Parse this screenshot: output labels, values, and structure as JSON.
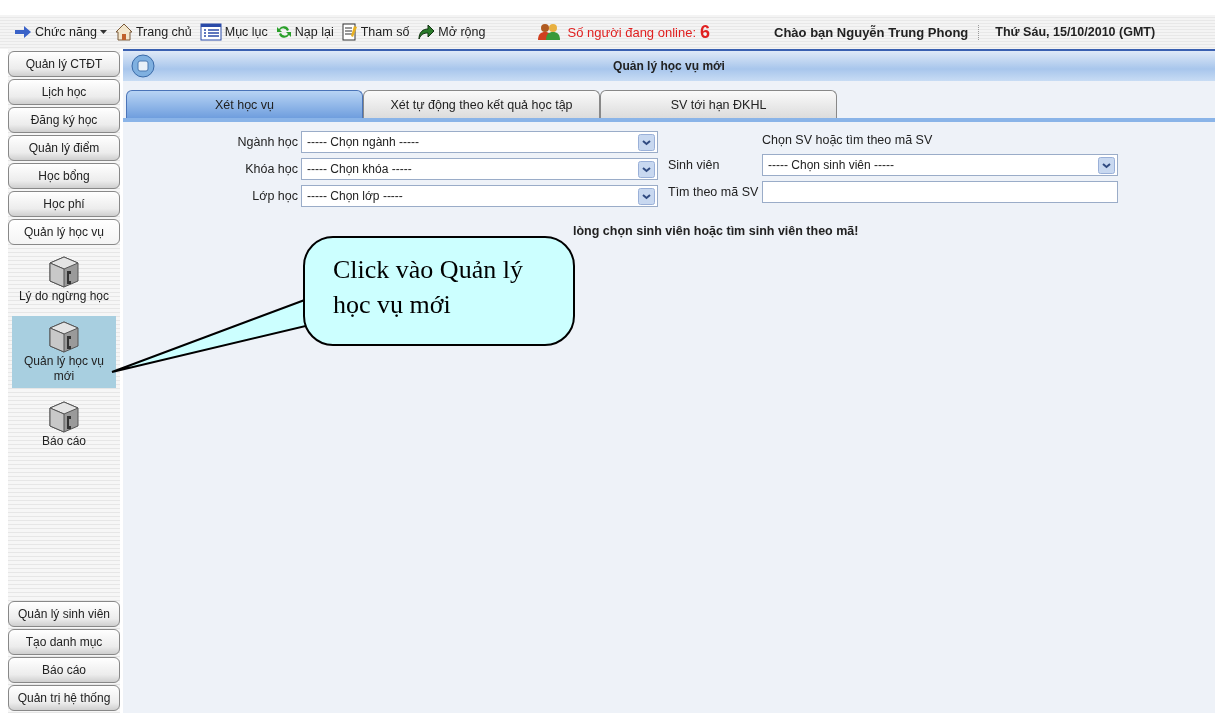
{
  "toolbar": {
    "items": [
      {
        "kind": "menu",
        "label": "Chức năng",
        "dropdown": true
      },
      {
        "kind": "home",
        "label": "Trang chủ",
        "dropdown": false
      },
      {
        "kind": "contents",
        "label": "Mục lục",
        "dropdown": false
      },
      {
        "kind": "reload",
        "label": "Nạp lại",
        "dropdown": false
      },
      {
        "kind": "params",
        "label": "Tham số",
        "dropdown": false
      },
      {
        "kind": "extend",
        "label": "Mở rộng",
        "dropdown": false
      }
    ],
    "online": {
      "label": "Số người đang online:",
      "count": "6"
    },
    "greeting": "Chào bạn Nguyễn Trung Phong",
    "date": "Thứ Sáu, 15/10/2010 (GMT)"
  },
  "sidebar": {
    "sections": [
      {
        "label": "Quản lý CTĐT",
        "expanded": false
      },
      {
        "label": "Lịch học",
        "expanded": false
      },
      {
        "label": "Đăng ký học",
        "expanded": false
      },
      {
        "label": "Quản lý điểm",
        "expanded": false
      },
      {
        "label": "Học bổng",
        "expanded": false
      },
      {
        "label": "Học phí",
        "expanded": false
      },
      {
        "label": "Quản lý học vụ",
        "expanded": true,
        "items": [
          {
            "label": "Lý do ngừng học",
            "selected": false
          },
          {
            "label": "Quản lý học vụ mới",
            "selected": true
          },
          {
            "label": "Báo cáo",
            "selected": false
          }
        ]
      },
      {
        "label": "Quản lý sinh viên",
        "expanded": false
      },
      {
        "label": "Tạo danh mục",
        "expanded": false
      },
      {
        "label": "Báo cáo",
        "expanded": false
      },
      {
        "label": "Quản trị hệ thống",
        "expanded": false
      }
    ]
  },
  "panel": {
    "title": "Quản lý học vụ mới",
    "tabs": [
      {
        "label": "Xét học vụ",
        "selected": true
      },
      {
        "label": "Xét tự động theo kết quả học tập",
        "selected": false
      },
      {
        "label": "SV tới hạn ĐKHL",
        "selected": false
      }
    ],
    "left_fields": [
      {
        "label": "Ngành học",
        "value": "----- Chọn ngành -----"
      },
      {
        "label": "Khóa học",
        "value": "----- Chọn khóa -----"
      },
      {
        "label": "Lớp học",
        "value": "----- Chọn lớp -----"
      }
    ],
    "right_heading": "Chọn SV hoặc tìm theo mã SV",
    "student_field": {
      "label": "Sinh viên",
      "value": "----- Chọn sinh viên -----"
    },
    "search_field": {
      "label": "Tìm theo mã SV"
    },
    "message": "lòng chọn sinh viên hoặc tìm sinh viên theo mã!"
  },
  "callout": {
    "text": "Click vào Quản lý học vụ mới"
  }
}
